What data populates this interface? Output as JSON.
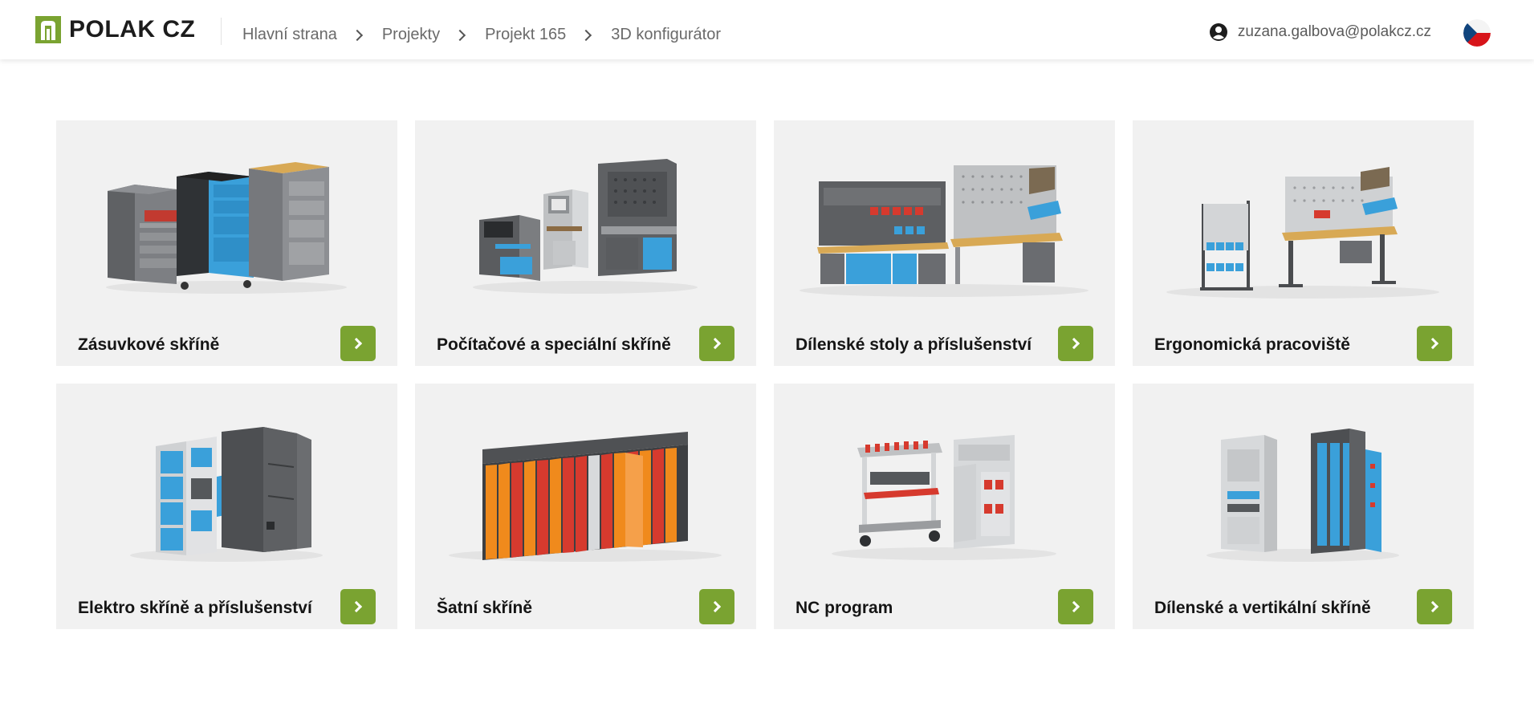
{
  "header": {
    "logo_text": "POLAK CZ",
    "brand_color": "#7aa331",
    "breadcrumb": [
      {
        "label": "Hlavní strana"
      },
      {
        "label": "Projekty"
      },
      {
        "label": "Projekt 165"
      },
      {
        "label": "3D konfigurátor"
      }
    ],
    "user_email": "zuzana.galbova@polakcz.cz",
    "user_icon": "account-circle-icon",
    "language_flag": "czech-flag-icon"
  },
  "categories": [
    {
      "title": "Zásuvkové skříně",
      "illustration": "drawer-cabinets"
    },
    {
      "title": "Počítačové a speciální skříně",
      "illustration": "computer-cabinets"
    },
    {
      "title": "Dílenské stoly a příslušenství",
      "illustration": "workshop-tables"
    },
    {
      "title": "Ergonomická pracoviště",
      "illustration": "ergonomic-workstations"
    },
    {
      "title": "Elektro skříně a příslušenství",
      "illustration": "electro-cabinets"
    },
    {
      "title": "Šatní skříně",
      "illustration": "locker-cabinets"
    },
    {
      "title": "NC program",
      "illustration": "nc-program"
    },
    {
      "title": "Dílenské a vertikální skříně",
      "illustration": "vertical-cabinets"
    }
  ],
  "colors": {
    "card_bg": "#f1f1f1",
    "button_bg": "#7aa331",
    "accent_blue": "#3a9fd8",
    "accent_red": "#d63a2e",
    "accent_orange": "#f08a1c",
    "metal_gray": "#6d6f72"
  }
}
